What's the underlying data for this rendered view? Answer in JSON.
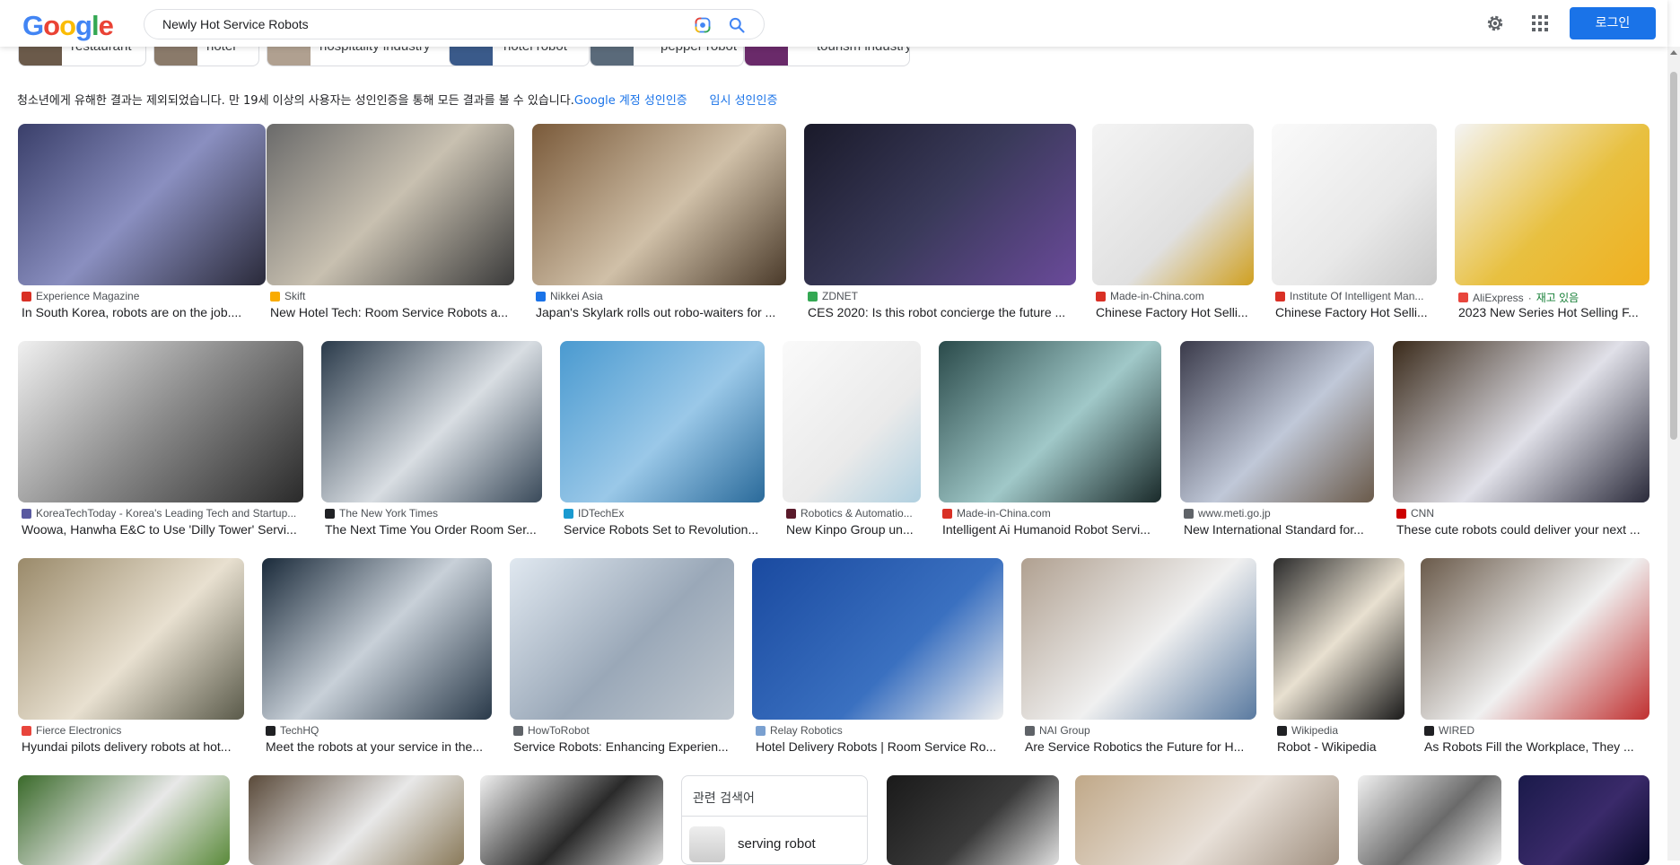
{
  "header": {
    "logo_text": "Google",
    "search_value": "Newly Hot Service Robots",
    "login_label": "로그인"
  },
  "chips": [
    {
      "label": "restaurant",
      "color": "#6b5a4a"
    },
    {
      "label": "hotel",
      "color": "#8a7a6a"
    },
    {
      "label": "hospitality industry",
      "color": "#b0a090"
    },
    {
      "label": "hotel robot",
      "color": "#3a5a8a"
    },
    {
      "label": "pepper robot",
      "color": "#5a6a7a"
    },
    {
      "label": "tourism industry",
      "color": "#6a2a6a"
    }
  ],
  "notice": {
    "text": "청소년에게 유해한 결과는 제외되었습니다. 만 19세 이상의 사용자는 성인인증을 통해 모든 결과를 볼 수 있습니다.",
    "link1": "Google 계정 성인인증",
    "link2": "임시 성인인증"
  },
  "rows": [
    [
      {
        "source": "Experience Magazine",
        "title": "In South Korea, robots are on the job....",
        "fav": "#d93025",
        "bg": "linear-gradient(135deg,#3a3f6a,#8a8fc0 50%,#2a2a3a)"
      },
      {
        "source": "Skift",
        "title": "New Hotel Tech: Room Service Robots a...",
        "fav": "#f9ab00",
        "bg": "linear-gradient(135deg,#6a6a6a,#c8c0b0 50%,#3a3a3a)"
      },
      {
        "source": "Nikkei Asia",
        "title": "Japan's Skylark rolls out robo-waiters for ...",
        "fav": "#1a73e8",
        "bg": "linear-gradient(135deg,#7a5a3a,#d0c0a8 55%,#4a3a2a)"
      },
      {
        "source": "ZDNET",
        "title": "CES 2020: Is this robot concierge the future ...",
        "fav": "#34a853",
        "bg": "linear-gradient(135deg,#1a1a2a,#3a3a5a 50%,#6a4a9a)"
      },
      {
        "source": "Made-in-China.com",
        "title": "Chinese Factory Hot Selli...",
        "fav": "#d93025",
        "bg": "linear-gradient(135deg,#f4f4f4,#e0e0e0 60%,#d0a020)"
      },
      {
        "source": "Institute Of Intelligent Man...",
        "title": "Chinese Factory Hot Selli...",
        "fav": "#d93025",
        "bg": "linear-gradient(135deg,#fafafa,#e8e8e8 60%,#c8c8c8)"
      },
      {
        "source": "AliExpress",
        "stock": "재고 있음",
        "title": "2023 New Series Hot Selling F...",
        "fav": "#e8453c",
        "bg": "linear-gradient(135deg,#f4f4f4,#e8c040 55%,#f0b020)"
      }
    ],
    [
      {
        "source": "KoreaTechToday - Korea's Leading Tech and Startup...",
        "title": "Woowa, Hanwha E&C to Use 'Dilly Tower' Servi...",
        "fav": "#5a5aa0",
        "bg": "linear-gradient(135deg,#f0f0f0,#8a8a8a 50%,#2a2a2a)"
      },
      {
        "source": "The New York Times",
        "title": "The Next Time You Order Room Ser...",
        "fav": "#202124",
        "bg": "linear-gradient(135deg,#2a3a4a,#d8dde2 55%,#3a4a5a)"
      },
      {
        "source": "IDTechEx",
        "title": "Service Robots Set to Revolution...",
        "fav": "#1a9ad0",
        "bg": "linear-gradient(135deg,#4a9ad0,#9ac8e8 55%,#2a6a9a)"
      },
      {
        "source": "Robotics & Automatio...",
        "title": "New Kinpo Group un...",
        "fav": "#5a1a2a",
        "bg": "linear-gradient(135deg,#fafafa,#eaeaea 60%,#b0d0e0)"
      },
      {
        "source": "Made-in-China.com",
        "title": "Intelligent Ai Humanoid Robot Servi...",
        "fav": "#d93025",
        "bg": "linear-gradient(135deg,#2a4a4a,#a0c8c8 55%,#1a2a2a)"
      },
      {
        "source": "www.meti.go.jp",
        "title": "New International Standard for...",
        "fav": "#5f6368",
        "bg": "linear-gradient(135deg,#3a3a4a,#c0c8d8 55%,#6a5a4a)"
      },
      {
        "source": "CNN",
        "title": "These cute robots could deliver your next ...",
        "fav": "#cc0000",
        "bg": "linear-gradient(135deg,#3a2a1a,#e0e0e8 55%,#2a2a3a)"
      }
    ],
    [
      {
        "source": "Fierce Electronics",
        "title": "Hyundai pilots delivery robots at hot...",
        "fav": "#e8453c",
        "bg": "linear-gradient(135deg,#9a8a6a,#e8e0d0 55%,#5a5a4a)"
      },
      {
        "source": "TechHQ",
        "title": "Meet the robots at your service in the...",
        "fav": "#202124",
        "bg": "linear-gradient(135deg,#1a2a3a,#c8d0d8 50%,#2a3a4a)"
      },
      {
        "source": "HowToRobot",
        "title": "Service Robots: Enhancing Experien...",
        "fav": "#5f6368",
        "bg": "linear-gradient(135deg,#e0e8f0,#9aa8b8 55%,#c0c8d0)"
      },
      {
        "source": "Relay Robotics",
        "title": "Hotel Delivery Robots | Room Service Ro...",
        "fav": "#7aa0d0",
        "bg": "linear-gradient(135deg,#1a4aa0,#3a70c0 60%,#f0f0f0)"
      },
      {
        "source": "NAI Group",
        "title": "Are Service Robotics the Future for H...",
        "fav": "#5f6368",
        "bg": "linear-gradient(135deg,#b0a090,#f0f0f0 55%,#5a7aa0)"
      },
      {
        "source": "Wikipedia",
        "title": "Robot - Wikipedia",
        "fav": "#202124",
        "bg": "linear-gradient(135deg,#2a2a2a,#e8e0d0 50%,#1a1a1a)"
      },
      {
        "source": "WIRED",
        "title": "As Robots Fill the Workplace, They ...",
        "fav": "#202124",
        "bg": "linear-gradient(135deg,#6a5a4a,#f0f0f0 55%,#c03030)"
      }
    ],
    [
      {
        "bg": "linear-gradient(135deg,#3a6a2a,#e8e8e8 55%,#5a8a3a)"
      },
      {
        "bg": "linear-gradient(135deg,#5a4a3a,#e8e8e8 55%,#8a7a5a)"
      },
      {
        "bg": "linear-gradient(135deg,#f0f0f0,#2a2a2a 55%,#e0e0e0)"
      },
      {
        "bg": "linear-gradient(135deg,#1a1a1a,#3a3a3a 55%,#e0e0e0)"
      },
      {
        "bg": "linear-gradient(135deg,#c0a888,#e8e0d8 55%,#a09080)"
      },
      {
        "bg": "linear-gradient(135deg,#f0f0f0,#6a6a6a 55%,#f0f0f0)"
      },
      {
        "bg": "linear-gradient(135deg,#1a1a4a,#3a2a6a 55%,#0a0a2a)"
      }
    ]
  ],
  "related": {
    "title": "관련 검색어",
    "item": "serving robot"
  }
}
